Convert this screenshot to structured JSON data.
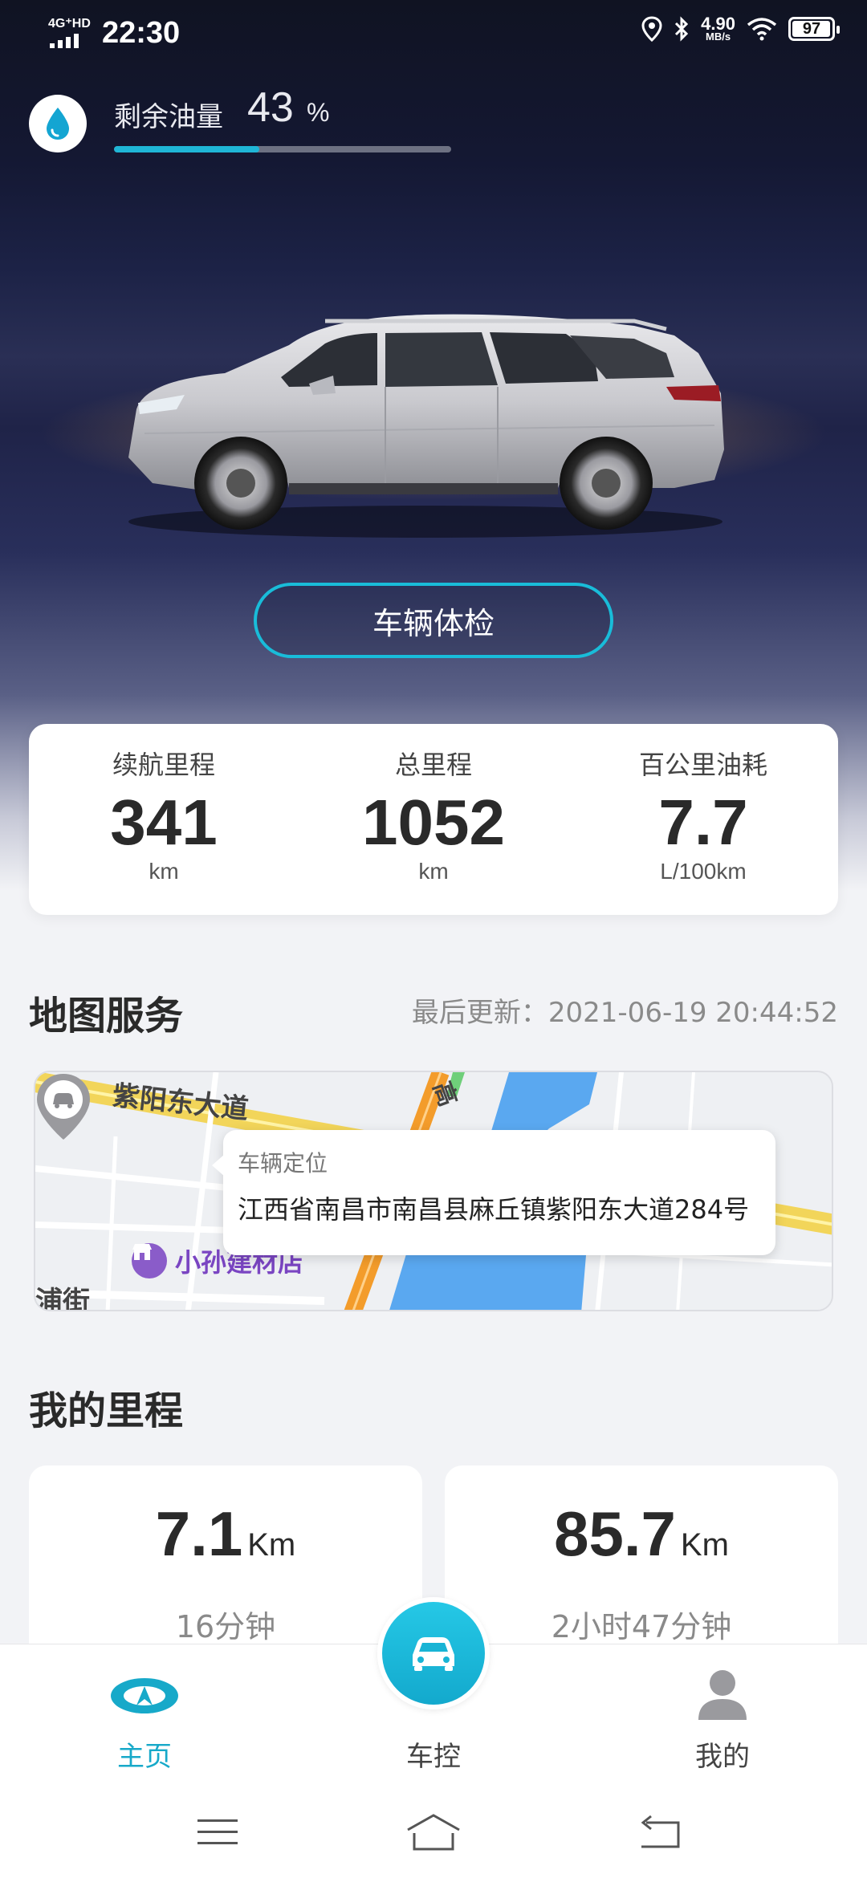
{
  "status_bar": {
    "network": "4G⁺HD",
    "time": "22:30",
    "speed_value": "4.90",
    "speed_unit": "MB/s",
    "battery": "97"
  },
  "fuel": {
    "label": "剩余油量",
    "value": "43",
    "unit": "%",
    "percent": 43,
    "icon": "water-drop-icon"
  },
  "check_button": {
    "label": "车辆体检"
  },
  "stats": [
    {
      "label": "续航里程",
      "value": "341",
      "unit": "km"
    },
    {
      "label": "总里程",
      "value": "1052",
      "unit": "km"
    },
    {
      "label": "百公里油耗",
      "value": "7.7",
      "unit": "L/100km"
    }
  ],
  "map_section": {
    "title": "地图服务",
    "updated": "最后更新：2021-06-19 20:44:52",
    "popup_title": "车辆定位",
    "popup_address": "江西省南昌市南昌县麻丘镇紫阳东大道284号",
    "road_label_1": "紫阳东大道",
    "road_label_2": "浦街",
    "road_label_3": "高",
    "poi_label": "小孙建材店"
  },
  "mileage_section": {
    "title": "我的里程",
    "cards": [
      {
        "value": "7.1",
        "unit": "Km",
        "time": "16分钟"
      },
      {
        "value": "85.7",
        "unit": "Km",
        "time": "2小时47分钟"
      }
    ]
  },
  "bottom_nav": {
    "items": [
      {
        "label": "主页",
        "icon": "brand-logo-icon",
        "active": true
      },
      {
        "label": "车控",
        "icon": "car-icon",
        "active": false
      },
      {
        "label": "我的",
        "icon": "person-icon",
        "active": false
      }
    ]
  },
  "colors": {
    "accent": "#19bcd9",
    "background": "#f2f3f6",
    "hero_dark": "#141833"
  }
}
